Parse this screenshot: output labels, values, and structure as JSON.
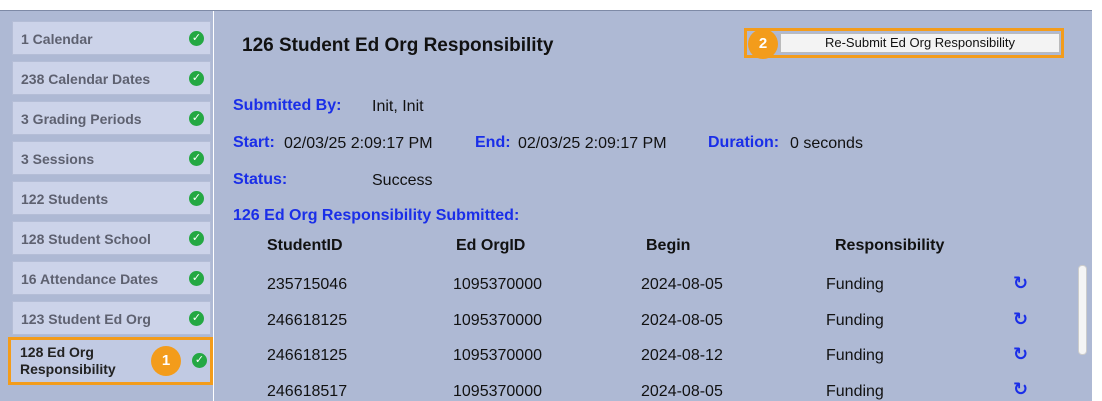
{
  "sidebar": {
    "items": [
      {
        "label": "1 Calendar"
      },
      {
        "label": "238 Calendar Dates"
      },
      {
        "label": "3 Grading Periods"
      },
      {
        "label": "3 Sessions"
      },
      {
        "label": "122 Students"
      },
      {
        "label": "128 Student School"
      },
      {
        "label": "16 Attendance Dates"
      },
      {
        "label": "123 Student Ed Org"
      },
      {
        "label_line1": "128 Ed Org",
        "label_line2": "Responsibility"
      }
    ],
    "badge1": "1"
  },
  "main": {
    "title": "126 Student Ed Org Responsibility",
    "resubmit_label": "Re-Submit Ed Org Responsibility",
    "badge2": "2",
    "submitted_by_label": "Submitted By:",
    "submitted_by_value": "Init, Init",
    "start_label": "Start:",
    "start_value": "02/03/25 2:09:17 PM",
    "end_label": "End:",
    "end_value": "02/03/25 2:09:17 PM",
    "duration_label": "Duration:",
    "duration_value": "0 seconds",
    "status_label": "Status:",
    "status_value": "Success",
    "section_heading": "126 Ed Org Responsibility Submitted:",
    "columns": [
      "StudentID",
      "Ed OrgID",
      "Begin",
      "Responsibility"
    ],
    "rows": [
      [
        "235715046",
        "1095370000",
        "2024-08-05",
        "Funding"
      ],
      [
        "246618125",
        "1095370000",
        "2024-08-05",
        "Funding"
      ],
      [
        "246618125",
        "1095370000",
        "2024-08-12",
        "Funding"
      ],
      [
        "246618517",
        "1095370000",
        "2024-08-05",
        "Funding"
      ]
    ]
  }
}
